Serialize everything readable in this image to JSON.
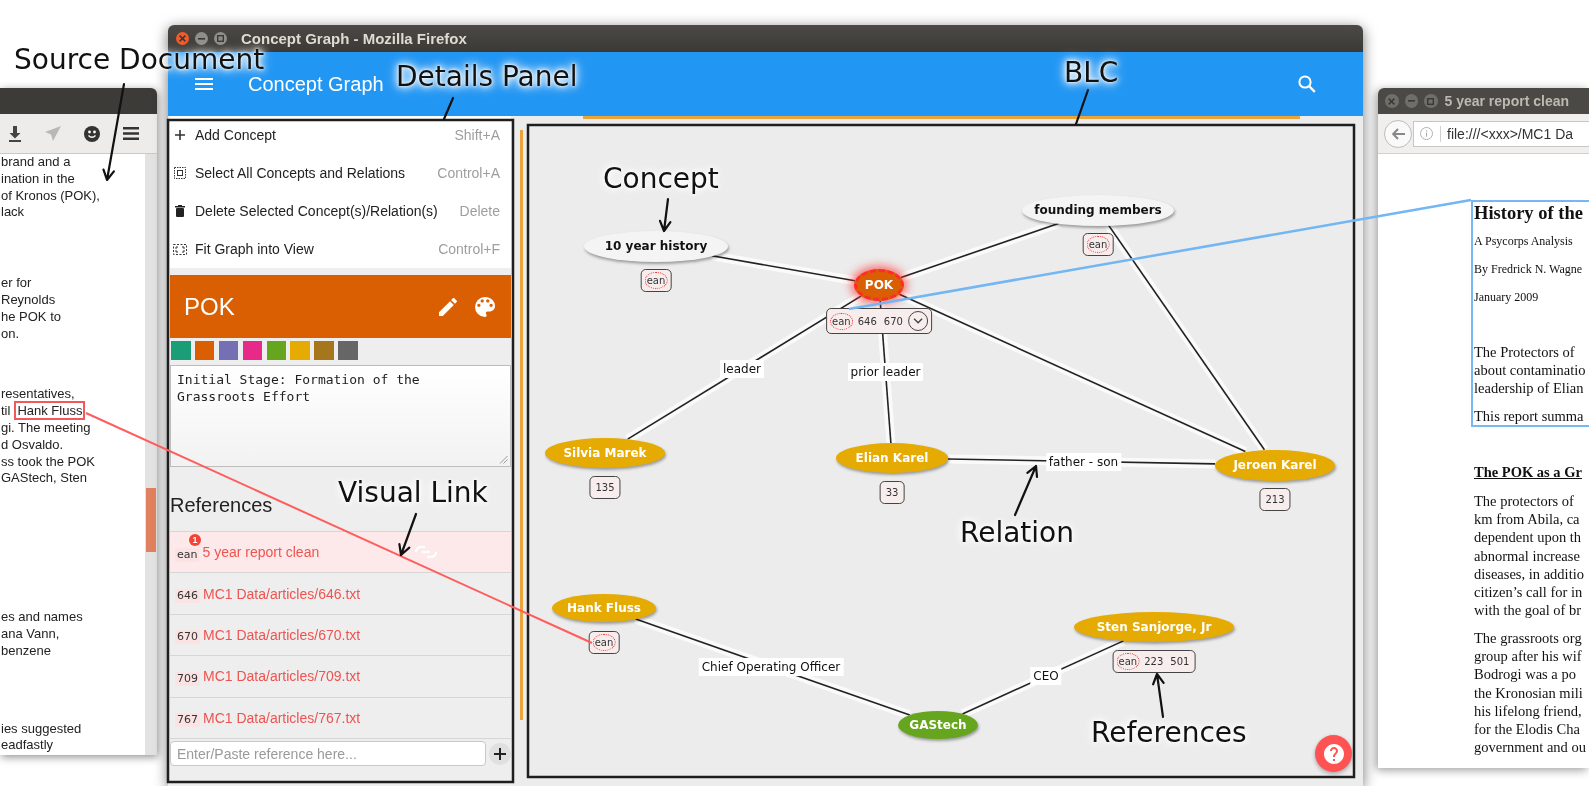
{
  "source_window": {
    "paragraphs": [
      {
        "lines": [
          {
            "text": "brand and a"
          },
          {
            "text": "ination in the"
          },
          {
            "text": "of Kronos (POK),"
          },
          {
            "text": "lack"
          }
        ]
      },
      {
        "lines": [
          {
            "text": "er for"
          },
          {
            "text": "Reynolds"
          },
          {
            "text": "he POK to"
          },
          {
            "text": "on."
          }
        ]
      },
      {
        "lines": [
          {
            "text": "resentatives,"
          },
          {
            "text": "til",
            "highlight": "Hank Fluss"
          },
          {
            "text": "gi. The meeting"
          },
          {
            "text": "d Osvaldo."
          },
          {
            "text": "ss took the POK"
          },
          {
            "text": "GAStech, Sten"
          }
        ]
      },
      {
        "lines": [
          {
            "text": "es and names"
          },
          {
            "text": "ana Vann,"
          },
          {
            "text": "benzene"
          }
        ]
      },
      {
        "lines": [
          {
            "text": "ies suggested"
          },
          {
            "text": "eadfastly"
          }
        ]
      }
    ]
  },
  "main_window": {
    "title": "Concept Graph - Mozilla Firefox",
    "app_title": "Concept Graph",
    "menu": [
      {
        "label": "Add Concept",
        "shortcut": "Shift+A"
      },
      {
        "label": "Select All Concepts and Relations",
        "shortcut": "Control+A"
      },
      {
        "label": "Delete Selected Concept(s)/Relation(s)",
        "shortcut": "Delete"
      },
      {
        "label": "Fit Graph into View",
        "shortcut": "Control+F"
      }
    ],
    "details": {
      "title": "POK",
      "swatches": [
        {
          "color": "#1b9e77"
        },
        {
          "color": "#d95f02"
        },
        {
          "color": "#7570b3"
        },
        {
          "color": "#e7298a"
        },
        {
          "color": "#66a61e"
        },
        {
          "color": "#e6ab02"
        },
        {
          "color": "#a6761d"
        },
        {
          "color": "#666666"
        }
      ],
      "description": "Initial Stage: Formation of the Grassroots Effort",
      "references_heading": "References",
      "references": [
        {
          "tag": "ean",
          "badge": "1",
          "title": "5 year report clean",
          "selected": true
        },
        {
          "tag": "646",
          "title": "MC1 Data/articles/646.txt",
          "selected": false
        },
        {
          "tag": "670",
          "title": "MC1 Data/articles/670.txt",
          "selected": false
        },
        {
          "tag": "709",
          "title": "MC1 Data/articles/709.txt",
          "selected": false
        },
        {
          "tag": "767",
          "title": "MC1 Data/articles/767.txt",
          "selected": false
        }
      ],
      "reference_input": {
        "placeholder": "Enter/Paste reference here..."
      }
    },
    "graph": {
      "concepts": [
        {
          "label": "10 year history",
          "color": "#f4f4f4",
          "selected": false,
          "references": [
            {
              "label": "ean",
              "linked": true
            }
          ],
          "expand_button": false
        },
        {
          "label": "founding members",
          "color": "#f4f4f4",
          "selected": false,
          "references": [
            {
              "label": "ean",
              "linked": true
            }
          ],
          "expand_button": false
        },
        {
          "label": "POK",
          "color": "#d95f02",
          "selected": true,
          "references": [
            {
              "label": "ean",
              "linked": true
            },
            {
              "label": "646",
              "linked": false
            },
            {
              "label": "670",
              "linked": false
            }
          ],
          "expand_button": true
        },
        {
          "label": "Silvia Marek",
          "color": "#e6ab02",
          "selected": false,
          "references": [
            {
              "label": "135",
              "linked": false
            }
          ],
          "expand_button": false
        },
        {
          "label": "Elian Karel",
          "color": "#e6ab02",
          "selected": false,
          "references": [
            {
              "label": "33",
              "linked": false
            }
          ],
          "expand_button": false
        },
        {
          "label": "Jeroen Karel",
          "color": "#e6ab02",
          "selected": false,
          "references": [
            {
              "label": "213",
              "linked": false
            }
          ],
          "expand_button": false
        },
        {
          "label": "Hank Fluss",
          "color": "#e6ab02",
          "selected": false,
          "references": [
            {
              "label": "ean",
              "linked": true
            }
          ],
          "expand_button": false
        },
        {
          "label": "Sten Sanjorge, Jr",
          "color": "#e6ab02",
          "selected": false,
          "references": [
            {
              "label": "ean",
              "linked": true
            },
            {
              "label": "223",
              "linked": false
            },
            {
              "label": "501",
              "linked": false
            }
          ],
          "expand_button": false
        },
        {
          "label": "GAStech",
          "color": "#66a61e",
          "selected": false,
          "expand_button": false
        }
      ],
      "relations": [
        {
          "label": "leader"
        },
        {
          "label": "prior leader"
        },
        {
          "label": "father - son"
        },
        {
          "label": "Chief Operating Officer"
        },
        {
          "label": "CEO"
        }
      ]
    }
  },
  "report_window": {
    "title": "5 year report clean",
    "url": "file:///<xxx>/MC1 Da",
    "heading": "History of the",
    "meta": [
      "A Psycorps Analysis",
      "By Fredrick N. Wagne",
      "January 2009"
    ],
    "intro": [
      [
        "The Protectors of",
        "about contaminatio",
        "leadership of Elian"
      ],
      [
        "This report summa"
      ]
    ],
    "section_heading": "The POK as a Gr",
    "paragraphs": [
      [
        "The protectors of",
        "km from Abila, ca",
        "dependent upon th",
        "abnormal increase",
        "diseases, in additio",
        "citizen’s call for in",
        "with the goal of br"
      ],
      [
        "The grassroots org",
        "group after his wif",
        "Bodrogi was a po",
        "the Kronosian mili",
        "his lifelong friend,",
        "for the Elodis Cha",
        "government and ou"
      ]
    ]
  },
  "annotations": [
    {
      "text": "Source Document",
      "kind": "arrow"
    },
    {
      "text": "Details Panel",
      "kind": "leader"
    },
    {
      "text": "BLC",
      "kind": "leader"
    },
    {
      "text": "Concept",
      "kind": "arrow"
    },
    {
      "text": "Visual Link",
      "kind": "arrow"
    },
    {
      "text": "Relation",
      "kind": "arrow"
    },
    {
      "text": "References",
      "kind": "arrow"
    }
  ]
}
